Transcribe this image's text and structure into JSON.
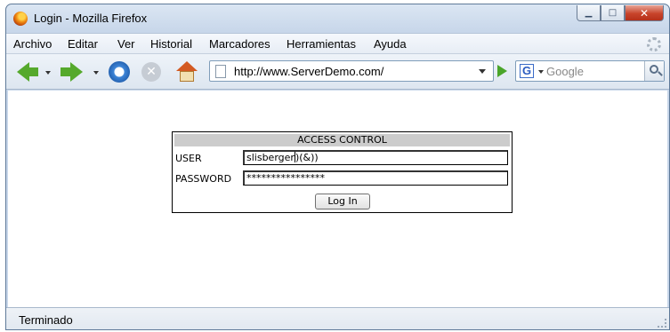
{
  "window": {
    "title": "Login - Mozilla Firefox"
  },
  "menubar": {
    "items": [
      "Archivo",
      "Editar",
      "Ver",
      "Historial",
      "Marcadores",
      "Herramientas",
      "Ayuda"
    ]
  },
  "toolbar": {
    "url": "http://www.ServerDemo.com/",
    "search_placeholder": "Google",
    "search_engine_icon": "G"
  },
  "form": {
    "header": "ACCESS CONTROL",
    "user_label": "USER",
    "user_value": "slisberger",
    "user_value_after_caret": ")(&))",
    "password_label": "PASSWORD",
    "password_value": "****************",
    "login_button": "Log In"
  },
  "statusbar": {
    "text": "Terminado"
  },
  "icons": {
    "back": "back-arrow-icon",
    "forward": "forward-arrow-icon",
    "reload": "reload-icon",
    "stop": "stop-icon",
    "home": "home-icon",
    "go": "go-icon",
    "search": "search-icon"
  },
  "colors": {
    "chrome": "#c8d7ea",
    "nav_green": "#55a92c",
    "close_red": "#c8442a",
    "form_header": "#cccccc"
  }
}
